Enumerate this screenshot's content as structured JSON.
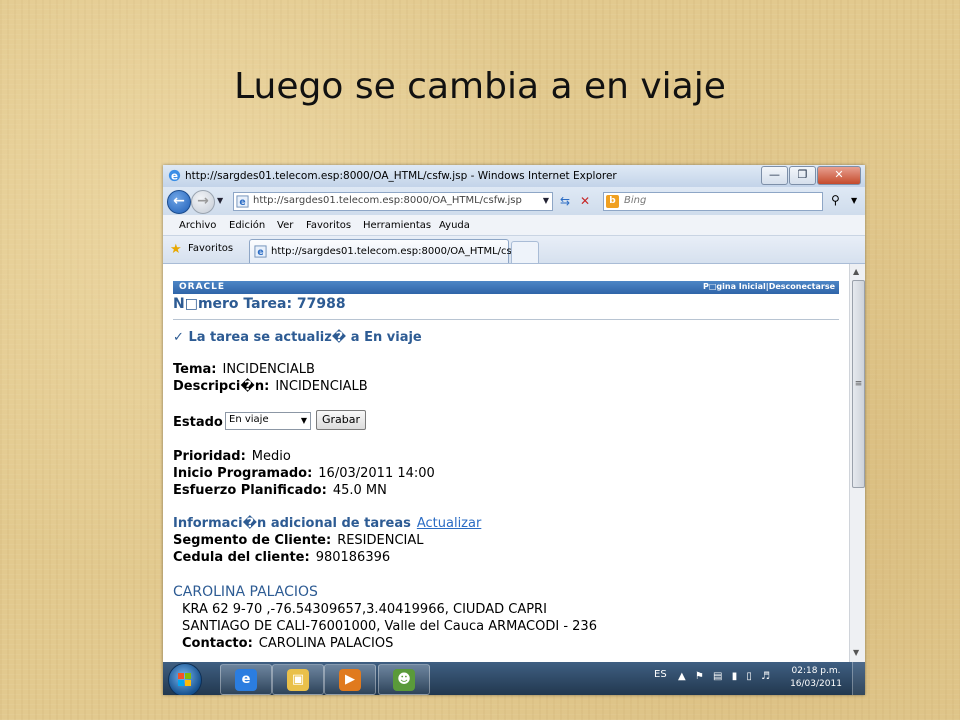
{
  "slide": {
    "title": "Luego se cambia a en viaje"
  },
  "browser": {
    "window_title": "http://sargdes01.telecom.esp:8000/OA_HTML/csfw.jsp - Windows Internet Explorer",
    "address": "http://sargdes01.telecom.esp:8000/OA_HTML/csfw.jsp",
    "search_placeholder": "Bing",
    "menu": [
      "Archivo",
      "Edición",
      "Ver",
      "Favoritos",
      "Herramientas",
      "Ayuda"
    ],
    "favorites_label": "Favoritos",
    "tab_title": "http://sargdes01.telecom.esp:8000/OA_HTML/cs..."
  },
  "page": {
    "logo": "ORACLE",
    "top_links": "P□gina Inicial|Desconectarse",
    "heading": "N□mero Tarea: 77988",
    "confirmation": "La tarea se actualiz� a En viaje",
    "tema_label": "Tema:",
    "tema_value": "INCIDENCIALB",
    "descripcion_label": "Descripci�n:",
    "descripcion_value": "INCIDENCIALB",
    "estado_label": "Estado",
    "estado_value": "En viaje",
    "grabar_button": "Grabar",
    "prioridad_label": "Prioridad:",
    "prioridad_value": "Medio",
    "inicio_label": "Inicio Programado:",
    "inicio_value": "16/03/2011 14:00",
    "esfuerzo_label": "Esfuerzo Planificado:",
    "esfuerzo_value": "45.0 MN",
    "info_heading": "Informaci�n adicional de tareas",
    "actualizar_link": "Actualizar",
    "segmento_label": "Segmento de Cliente:",
    "segmento_value": "RESIDENCIAL",
    "cedula_label": "Cedula del cliente:",
    "cedula_value": "980186396",
    "customer_name": "CAROLINA PALACIOS",
    "address_line1": "KRA 62 9-70 ,-76.54309657,3.40419966, CIUDAD CAPRI",
    "address_line2": "SANTIAGO DE CALI-76001000, Valle del Cauca ARMACODI - 236",
    "contacto_label": "Contacto:",
    "contacto_value": "CAROLINA PALACIOS"
  },
  "taskbar": {
    "language": "ES",
    "time": "02:18 p.m.",
    "date": "16/03/2011"
  }
}
